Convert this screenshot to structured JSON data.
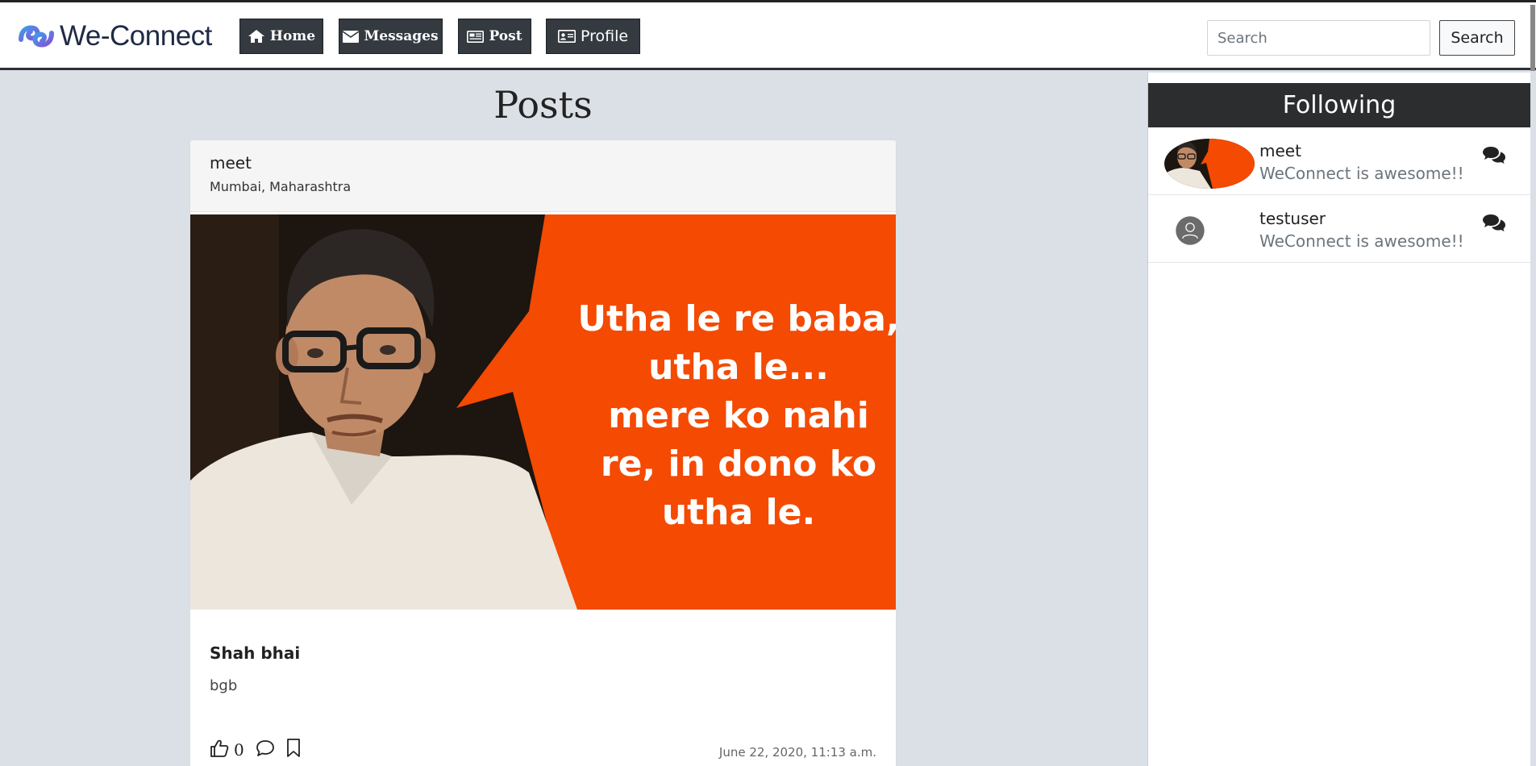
{
  "brand": {
    "name": "We-Connect"
  },
  "nav": {
    "home_label": "Home",
    "messages_label": "Messages",
    "post_label": "Post",
    "profile_label": "Profile",
    "search_placeholder": "Search",
    "search_button": "Search"
  },
  "posts": {
    "heading": "Posts",
    "items": [
      {
        "author": "meet",
        "location": "Mumbai, Maharashtra",
        "image_text": [
          "Utha le re baba,",
          "utha le...",
          "mere ko nahi",
          "re, in dono ko",
          "utha le."
        ],
        "title": "Shah bhai",
        "body": "bgb",
        "likes": "0",
        "timestamp": "June 22, 2020, 11:13 a.m."
      }
    ]
  },
  "following": {
    "heading": "Following",
    "items": [
      {
        "name": "meet",
        "status": "WeConnect is awesome!!"
      },
      {
        "name": "testuser",
        "status": "WeConnect is awesome!!"
      }
    ]
  },
  "colors": {
    "navbar_button": "#343a40",
    "page_bg": "#dbe0e7",
    "meme_orange": "#f44a02",
    "sidebar_header": "#2b2d2f"
  }
}
